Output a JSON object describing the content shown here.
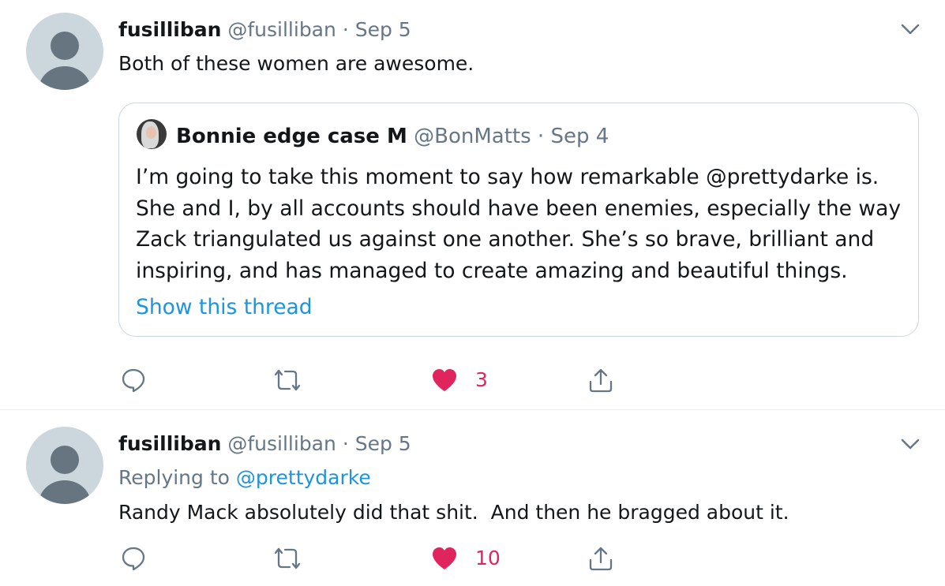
{
  "tweets": [
    {
      "author_name": "fusilliban",
      "handle": "@fusilliban",
      "separator": "·",
      "date": "Sep 5",
      "text": "Both of these women are awesome.",
      "quote": {
        "author_name": "Bonnie edge case M",
        "handle": "@BonMatts",
        "separator": "·",
        "date": "Sep 4",
        "lines": [
          "I’m going to take this moment to say how remarkable @prettydarke is.",
          "She and I, by all accounts should have been enemies, especially the way",
          "Zack triangulated us against one another. She’s so brave, brilliant and",
          "inspiring, and has managed to create amazing and beautiful things."
        ],
        "show_thread": "Show this thread"
      },
      "like_count": "3"
    },
    {
      "author_name": "fusilliban",
      "handle": "@fusilliban",
      "separator": "·",
      "date": "Sep 5",
      "replying_label": "Replying to",
      "replying_to": "@prettydarke",
      "text": "Randy Mack absolutely did that shit.  And then he bragged about it.",
      "like_count": "10"
    }
  ],
  "icons": {
    "reply": "reply-icon",
    "retweet": "retweet-icon",
    "like": "heart-icon",
    "share": "share-icon",
    "menu": "chevron-down-icon"
  },
  "colors": {
    "like": "#e0245e",
    "link": "#1b95e0",
    "muted": "#657786",
    "icon": "#657786",
    "border": "#ccd6dd"
  }
}
